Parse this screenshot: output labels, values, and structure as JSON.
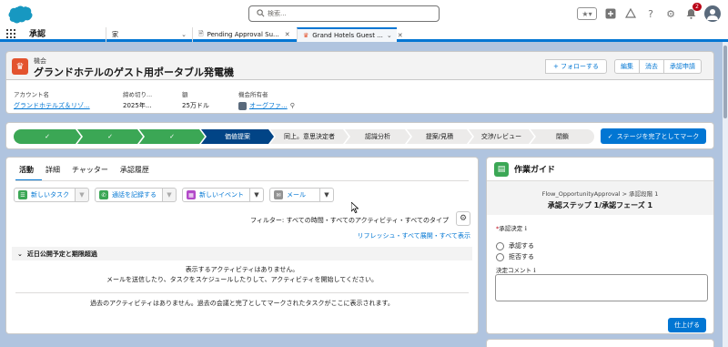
{
  "header": {
    "search_placeholder": "検索...",
    "fav_label": "★▾",
    "notification_count": "2"
  },
  "nav": {
    "app_name": "承認",
    "tabs": [
      {
        "label": "家"
      },
      {
        "label": "Pending Approval Su..."
      },
      {
        "label": "Grand Hotels Guest ..."
      }
    ]
  },
  "record": {
    "type": "機会",
    "title": "グランドホテルのゲスト用ポータブル発電機",
    "buttons": {
      "follow": "+ フォローする",
      "edit": "編集",
      "delete": "消去",
      "approve": "承認申請"
    },
    "fields": [
      {
        "label": "アカウント名",
        "value": "グランドホテルズ＆リゾ..."
      },
      {
        "label": "締め切り...",
        "value": "2025年..."
      },
      {
        "label": "額",
        "value": "25万ドル"
      },
      {
        "label": "機会所有者",
        "value": "オーグファ..."
      }
    ]
  },
  "path": {
    "stages": [
      {
        "label": "✓",
        "state": "done"
      },
      {
        "label": "✓",
        "state": "done"
      },
      {
        "label": "✓",
        "state": "done"
      },
      {
        "label": "価値提案",
        "state": "current"
      },
      {
        "label": "同上。意思決定者",
        "state": "todo"
      },
      {
        "label": "認識分析",
        "state": "todo"
      },
      {
        "label": "提案/見積",
        "state": "todo"
      },
      {
        "label": "交渉/レビュー",
        "state": "todo"
      },
      {
        "label": "閉鎖",
        "state": "todo"
      }
    ],
    "complete_button": "ステージを完了としてマーク"
  },
  "activity": {
    "tabs": [
      "活動",
      "詳細",
      "チャッター",
      "承認履歴"
    ],
    "buttons": {
      "task": "新しいタスク",
      "call": "通話を記録する",
      "event": "新しいイベント",
      "email": "メール"
    },
    "filter": "フィルター: すべての時間・すべてのアクティビティ・すべてのタイプ",
    "links": "リフレッシュ・すべて展開・すべて表示",
    "section": "近日公開予定と期限超過",
    "empty1_line1": "表示するアクティビティはありません。",
    "empty1_line2": "メールを送信したり、タスクをスケジュールしたりして、アクティビティを開始してください。",
    "empty2": "過去のアクティビティはありません。過去の会議と完了としてマークされたタスクがここに表示されます。"
  },
  "guide": {
    "title": "作業ガイド",
    "crumb": "Flow_OpportunityApproval > 承認段階 1",
    "step": "承認ステップ 1/承認フェーズ 1",
    "q1": "承認決定",
    "opt1": "承認する",
    "opt2": "拒否する",
    "q2": "決定コメント",
    "finish": "仕上げる"
  },
  "colors": {
    "brand": "#0176d3",
    "done": "#3ba755",
    "current": "#014486",
    "record_icon": "#e3532e"
  }
}
